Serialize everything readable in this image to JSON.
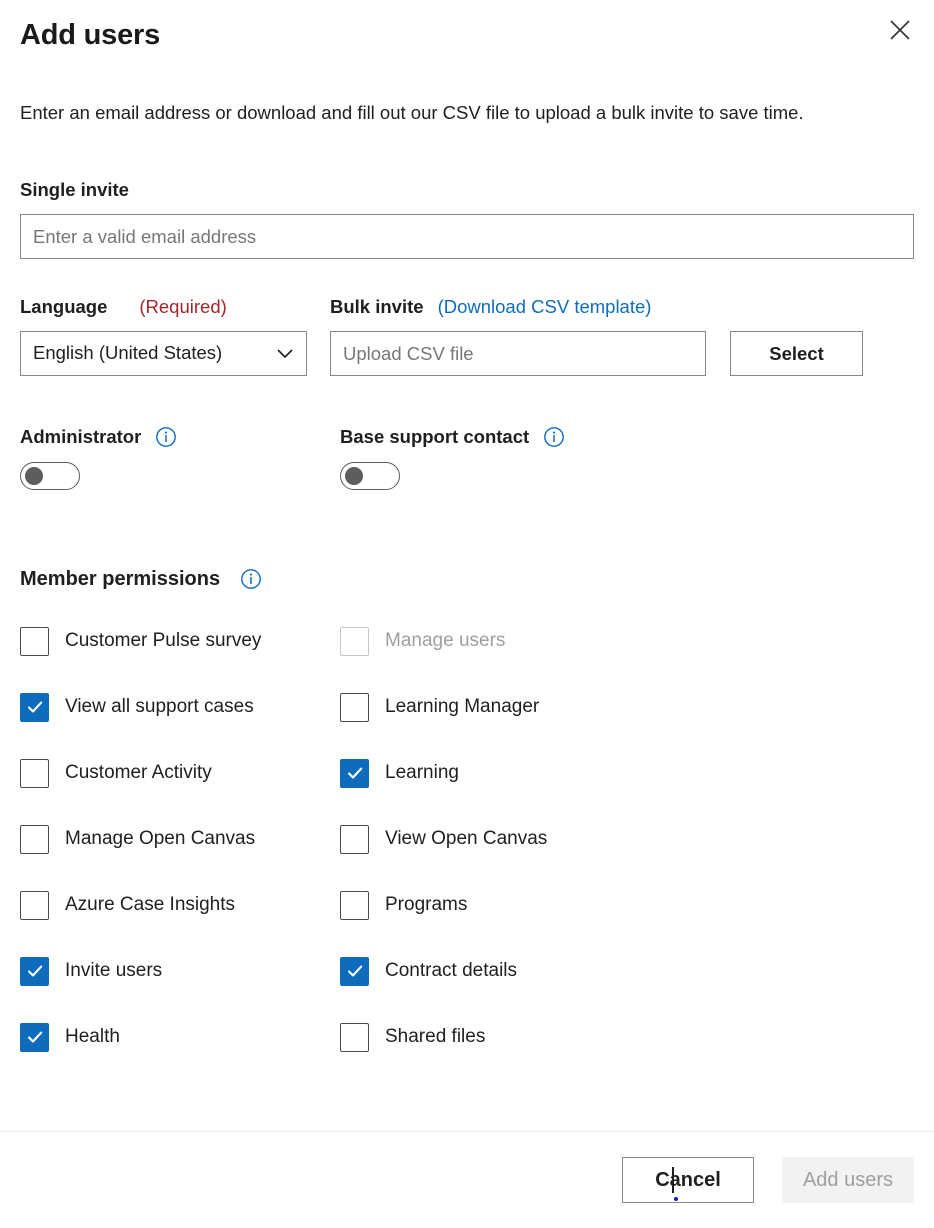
{
  "dialog": {
    "title": "Add users",
    "close_icon": "close-icon",
    "description": "Enter an email address or download and fill out our CSV file to upload a bulk invite to save time."
  },
  "single_invite": {
    "label": "Single invite",
    "placeholder": "Enter a valid email address",
    "value": ""
  },
  "language": {
    "label": "Language",
    "required_tag": "(Required)",
    "selected": "English (United States)",
    "chevron_icon": "chevron-down-icon"
  },
  "bulk_invite": {
    "label": "Bulk invite",
    "link": "(Download CSV template)",
    "placeholder": "Upload CSV file",
    "value": "",
    "select_button": "Select"
  },
  "administrator": {
    "label": "Administrator",
    "info_icon": "info-icon",
    "enabled": false
  },
  "base_support_contact": {
    "label": "Base support contact",
    "info_icon": "info-icon",
    "enabled": false
  },
  "member_permissions": {
    "title": "Member permissions",
    "info_icon": "info-icon",
    "left_column": [
      {
        "label": "Customer Pulse survey",
        "checked": false,
        "disabled": false
      },
      {
        "label": "View all support cases",
        "checked": true,
        "disabled": false
      },
      {
        "label": "Customer Activity",
        "checked": false,
        "disabled": false
      },
      {
        "label": "Manage Open Canvas",
        "checked": false,
        "disabled": false
      },
      {
        "label": "Azure Case Insights",
        "checked": false,
        "disabled": false
      },
      {
        "label": "Invite users",
        "checked": true,
        "disabled": false
      },
      {
        "label": "Health",
        "checked": true,
        "disabled": false
      }
    ],
    "right_column": [
      {
        "label": "Manage users",
        "checked": false,
        "disabled": true
      },
      {
        "label": "Learning Manager",
        "checked": false,
        "disabled": false
      },
      {
        "label": "Learning",
        "checked": true,
        "disabled": false
      },
      {
        "label": "View Open Canvas",
        "checked": false,
        "disabled": false
      },
      {
        "label": "Programs",
        "checked": false,
        "disabled": false
      },
      {
        "label": "Contract details",
        "checked": true,
        "disabled": false
      },
      {
        "label": "Shared files",
        "checked": false,
        "disabled": false
      }
    ]
  },
  "footer": {
    "cancel_label": "Cancel",
    "submit_label": "Add users",
    "submit_disabled": true
  },
  "colors": {
    "accent": "#0f6cbd",
    "link": "#0f6cbd",
    "required": "#a4262c",
    "text": "#201f1e",
    "disabled_text": "#a19f9d",
    "border": "#8a8886",
    "disabled_bg": "#f3f2f1"
  }
}
